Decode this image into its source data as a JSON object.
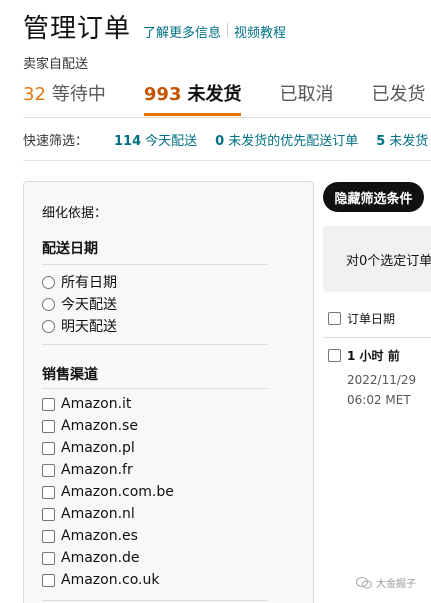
{
  "header": {
    "title": "管理订单",
    "learn_more": "了解更多信息",
    "video": "视频教程"
  },
  "subtitle": "卖家自配送",
  "tabs": [
    {
      "count": "32",
      "label": "等待中"
    },
    {
      "count": "993",
      "label": "未发货"
    },
    {
      "count": "",
      "label": "已取消"
    },
    {
      "count": "",
      "label": "已发货"
    }
  ],
  "quick_filter": {
    "label": "快速筛选：",
    "items": [
      {
        "count": "114",
        "label": "今天配送"
      },
      {
        "count": "0",
        "label": "未发货的优先配送订单"
      },
      {
        "count": "5",
        "label": "未发货"
      }
    ]
  },
  "refine": {
    "title": "细化依据：",
    "date_section": "配送日期",
    "date_options": [
      "所有日期",
      "今天配送",
      "明天配送"
    ],
    "channel_section": "销售渠道",
    "channels": [
      "Amazon.it",
      "Amazon.se",
      "Amazon.pl",
      "Amazon.fr",
      "Amazon.com.be",
      "Amazon.nl",
      "Amazon.es",
      "Amazon.de",
      "Amazon.co.uk"
    ]
  },
  "hide_filters_button": "隐藏筛选条件",
  "selection_text": "对0个选定订单",
  "table": {
    "col_order_date": "订单日期",
    "rows": [
      {
        "age": "1 小时 前",
        "date": "2022/11/29",
        "time": "06:02 MET"
      }
    ]
  },
  "watermark": "大金掘子"
}
